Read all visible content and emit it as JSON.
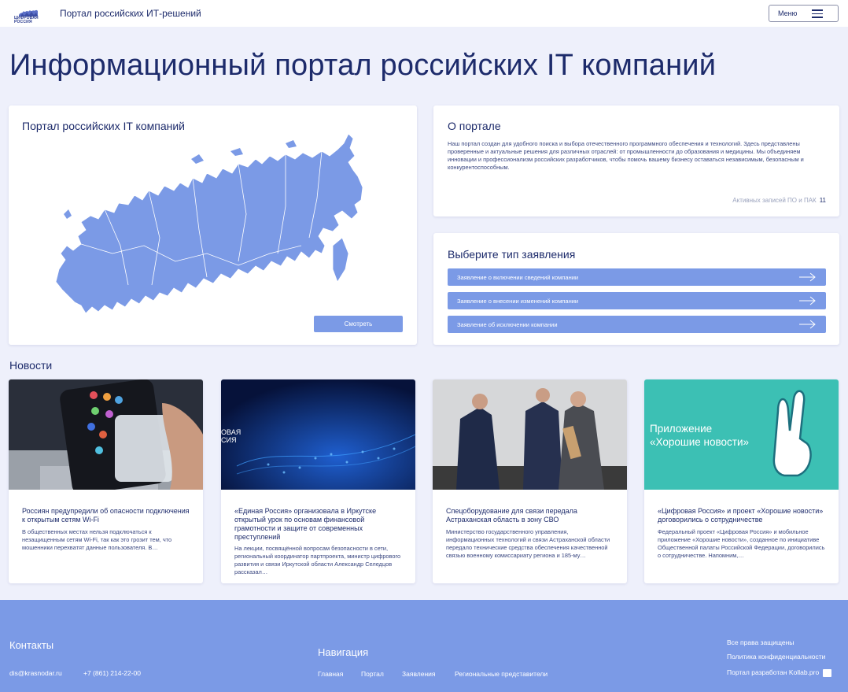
{
  "header": {
    "logo_text": "ЦИФРОВАЯ РОССИЯ",
    "site_title": "Портал российских ИТ-решений",
    "menu_label": "Меню"
  },
  "page_title": "Информационный портал российских IT компаний",
  "map_card": {
    "title": "Портал российских IT компаний",
    "button": "Смотреть"
  },
  "about": {
    "title": "О портале",
    "description": "Наш портал создан для удобного поиска и выбора отечественного программного обеспечения и технологий. Здесь представлены проверенные и актуальные решения для различных отраслей: от промышленности до образования и медицины. Мы объединяем инновации и профессионализм российских разработчиков, чтобы помочь вашему бизнесу оставаться независимым, безопасным и конкурентоспособным.",
    "active_label": "Активных записей ПО и ПАК",
    "active_count": "11"
  },
  "application": {
    "title": "Выберите тип заявления",
    "buttons": [
      "Заявление о включении сведений компании",
      "Заявление о внесении изменений компании",
      "Заявление об исключении компании"
    ]
  },
  "news": {
    "heading": "Новости",
    "items": [
      {
        "title": "Россиян предупредили об опасности подключения к открытым сетям Wi-Fi",
        "text": "В общественных местах нельзя подключаться к незащищенным сетям Wi-Fi, так как это грозит тем, что мошенники перехватят данные пользователя. В…"
      },
      {
        "title": "«Единая Россия» организовала в Иркутске открытый урок по основам финансовой грамотности и защите от современных преступлений",
        "text": "На лекции, посвящённой вопросам безопасности в сети, региональный координатор партпроекта, министр цифрового развития и связи Иркутской области Александр Селедцов рассказал…",
        "image_caption": "ОВАЯ\nСИЯ"
      },
      {
        "title": "Спецоборудование для связи передала Астраханская область в зону СВО",
        "text": "Министерство государственного управления, информационных технологий и связи Астраханской области передало технические средства обеспечения качественной связью военному комиссариату региона и 185-му…"
      },
      {
        "title": "«Цифровая Россия» и проект «Хорошие новости» договорились о сотрудничестве",
        "text": "Федеральный проект «Цифровая Россия» и мобильное приложение «Хорошие новости», созданное по инициативе Общественной палаты Российской Федерации, договорились о сотрудничестве. Напомним,…",
        "image_caption": "Приложение\n«Хорошие новости»"
      }
    ]
  },
  "footer": {
    "contacts_title": "Контакты",
    "email": "dis@krasnodar.ru",
    "phone": "+7 (861) 214-22-00",
    "nav_title": "Навигация",
    "nav_links": [
      "Главная",
      "Портал",
      "Заявления",
      "Региональные представители"
    ],
    "rights": "Все права защищены",
    "privacy": "Политика конфиденциальности",
    "developer": "Портал разработан Kollab.pro"
  },
  "colors": {
    "accent": "#7b9ae6",
    "text": "#1d2b6b",
    "background": "#eef0fb",
    "teal": "#3cc0b4"
  }
}
